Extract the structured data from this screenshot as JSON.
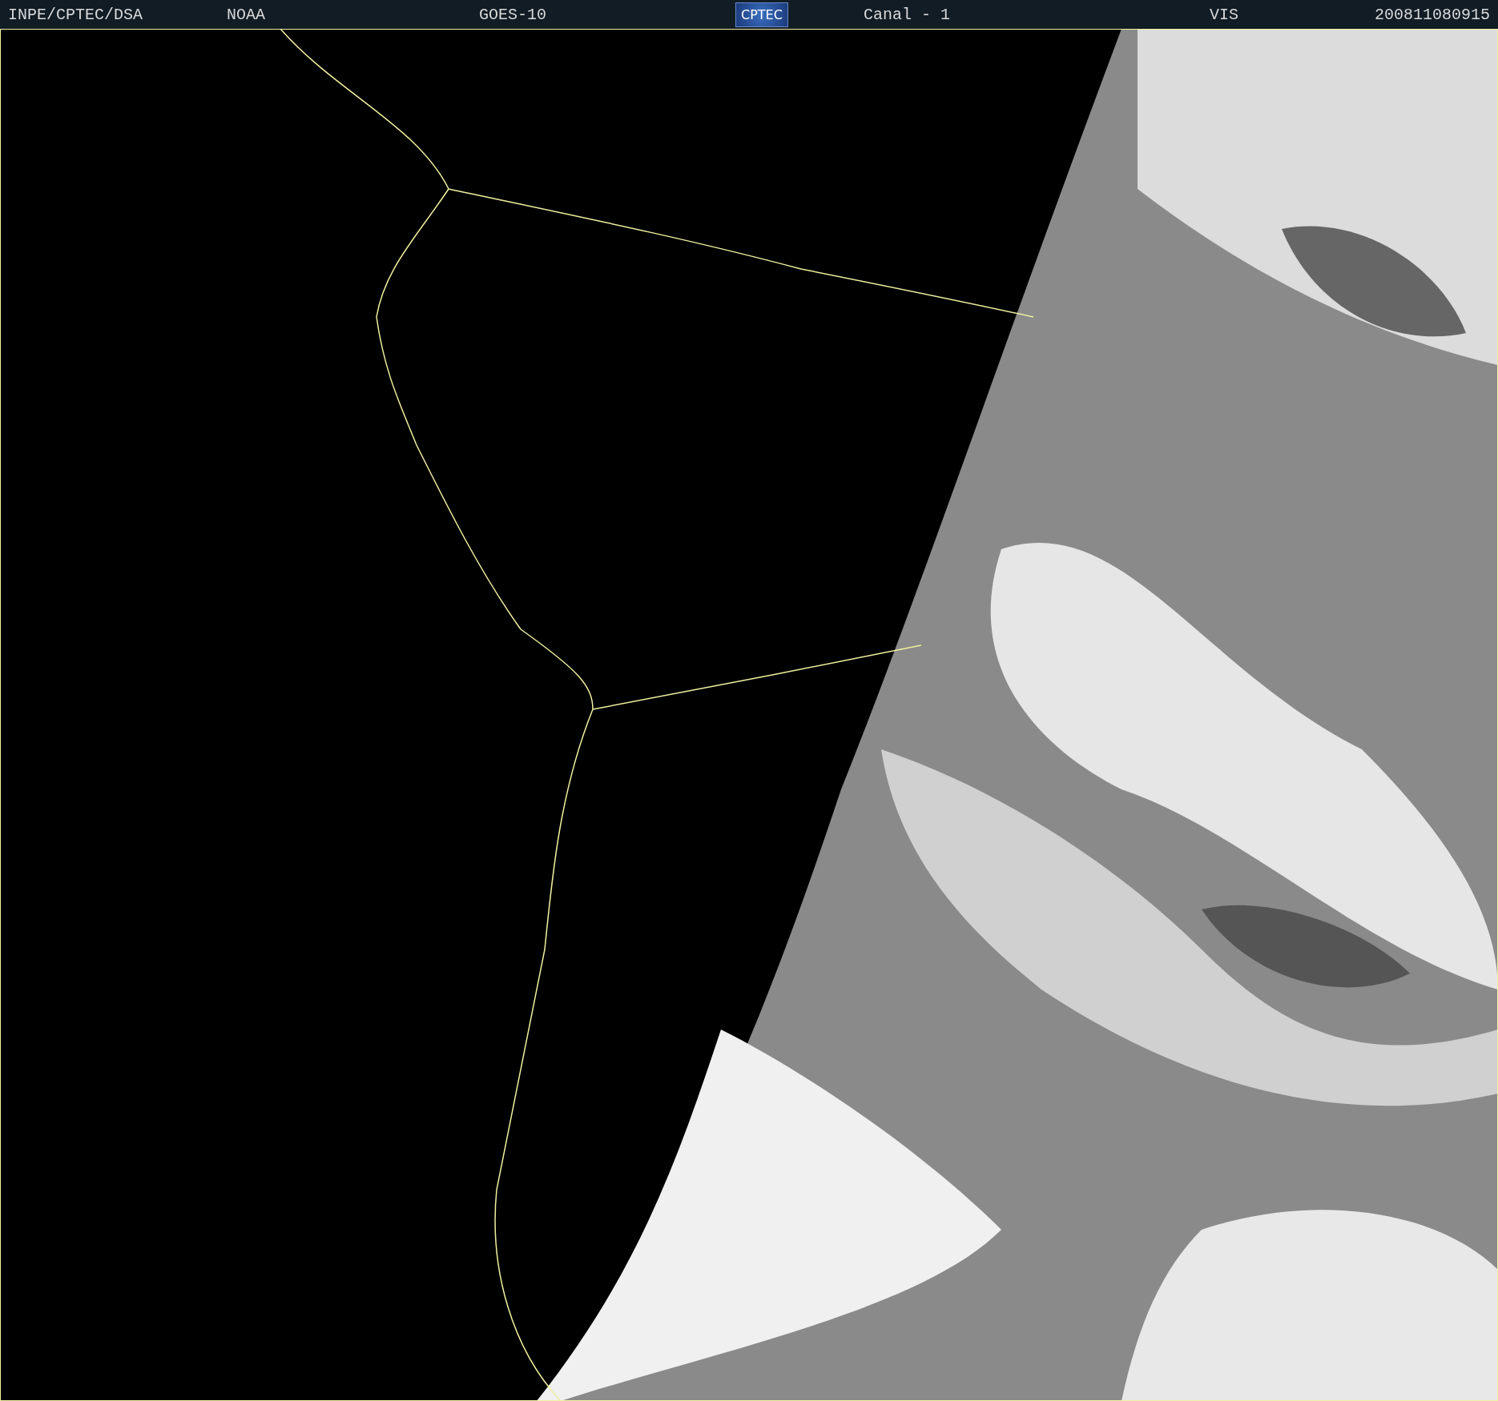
{
  "header": {
    "source": "INPE/CPTEC/DSA",
    "agency": "NOAA",
    "satellite": "GOES-10",
    "logo": "CPTEC",
    "channel": "Canal - 1",
    "band": "VIS",
    "timestamp": "200811080915"
  }
}
